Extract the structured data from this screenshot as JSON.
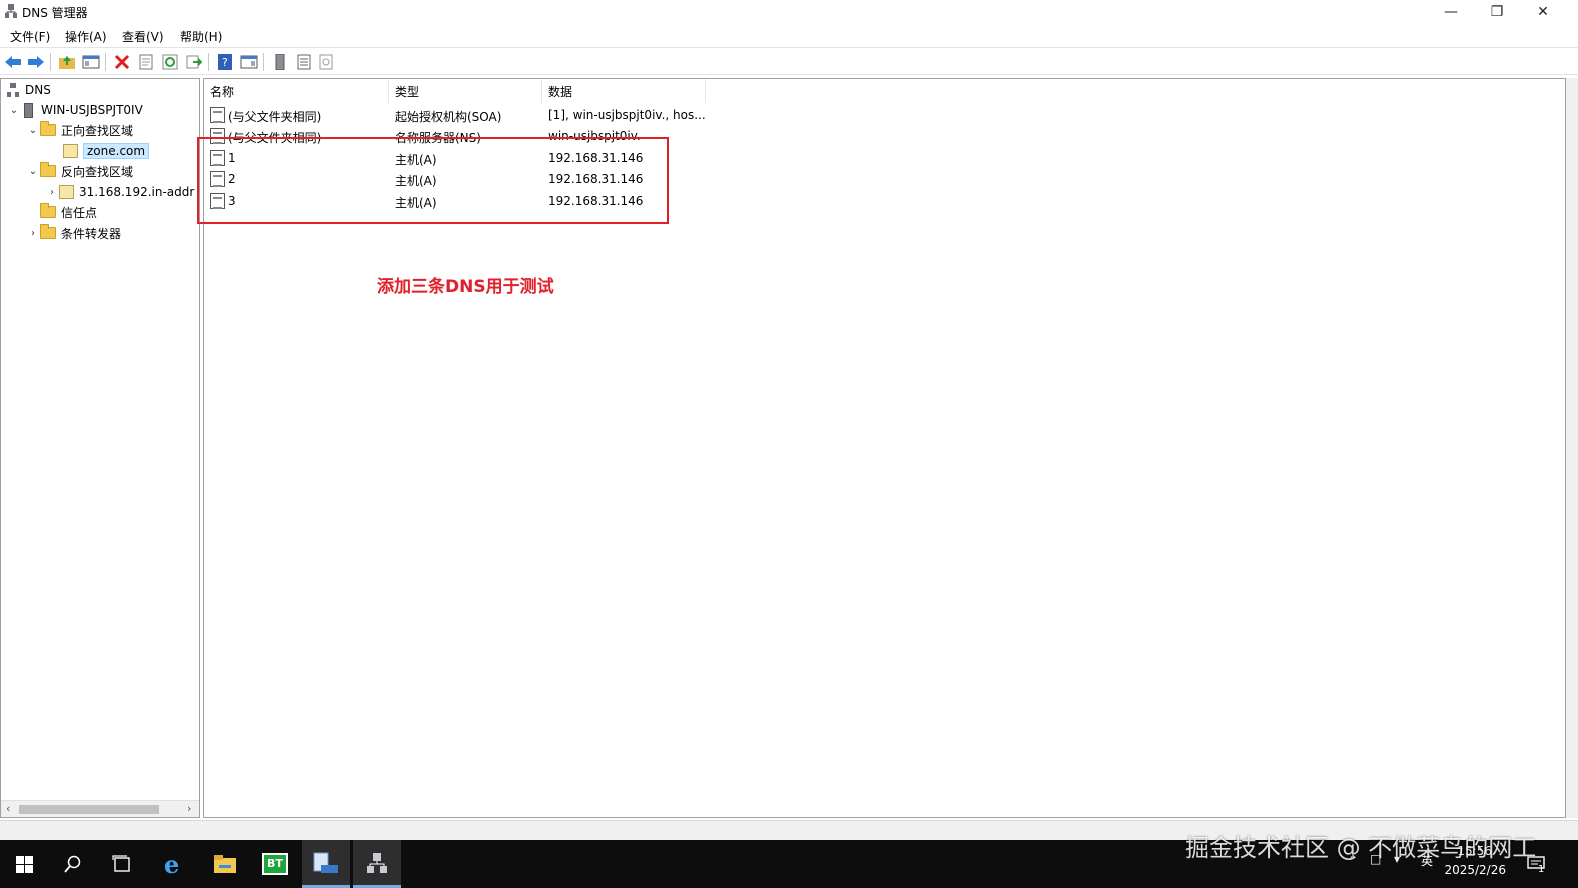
{
  "window": {
    "title": "DNS 管理器"
  },
  "menu": [
    "文件(F)",
    "操作(A)",
    "查看(V)",
    "帮助(H)"
  ],
  "tree": {
    "root": "DNS",
    "server": "WIN-USJBSPJT0IV",
    "forward_zones": "正向查找区域",
    "zone": "zone.com",
    "reverse_zones": "反向查找区域",
    "reverse_zone": "31.168.192.in-addr",
    "trust_points": "信任点",
    "conditional_forwarders": "条件转发器"
  },
  "list": {
    "columns": [
      "名称",
      "类型",
      "数据"
    ],
    "rows": [
      {
        "name": "(与父文件夹相同)",
        "type": "起始授权机构(SOA)",
        "data": "[1], win-usjbspjt0iv., hos..."
      },
      {
        "name": "(与父文件夹相同)",
        "type": "名称服务器(NS)",
        "data": "win-usjbspjt0iv."
      },
      {
        "name": "1",
        "type": "主机(A)",
        "data": "192.168.31.146"
      },
      {
        "name": "2",
        "type": "主机(A)",
        "data": "192.168.31.146"
      },
      {
        "name": "3",
        "type": "主机(A)",
        "data": "192.168.31.146"
      }
    ]
  },
  "annotation": "添加三条DNS用于测试",
  "taskbar": {
    "bt_label": "BT",
    "ime": "英",
    "time": "15:56",
    "date": "2025/2/26",
    "notif_count": "1"
  },
  "watermark": "掘金技术社区 @ 不做菜鸟的网工",
  "colors": {
    "annotation_red": "#e0202a",
    "selection": "#cce8ff",
    "taskbar": "#0d0d0d"
  }
}
